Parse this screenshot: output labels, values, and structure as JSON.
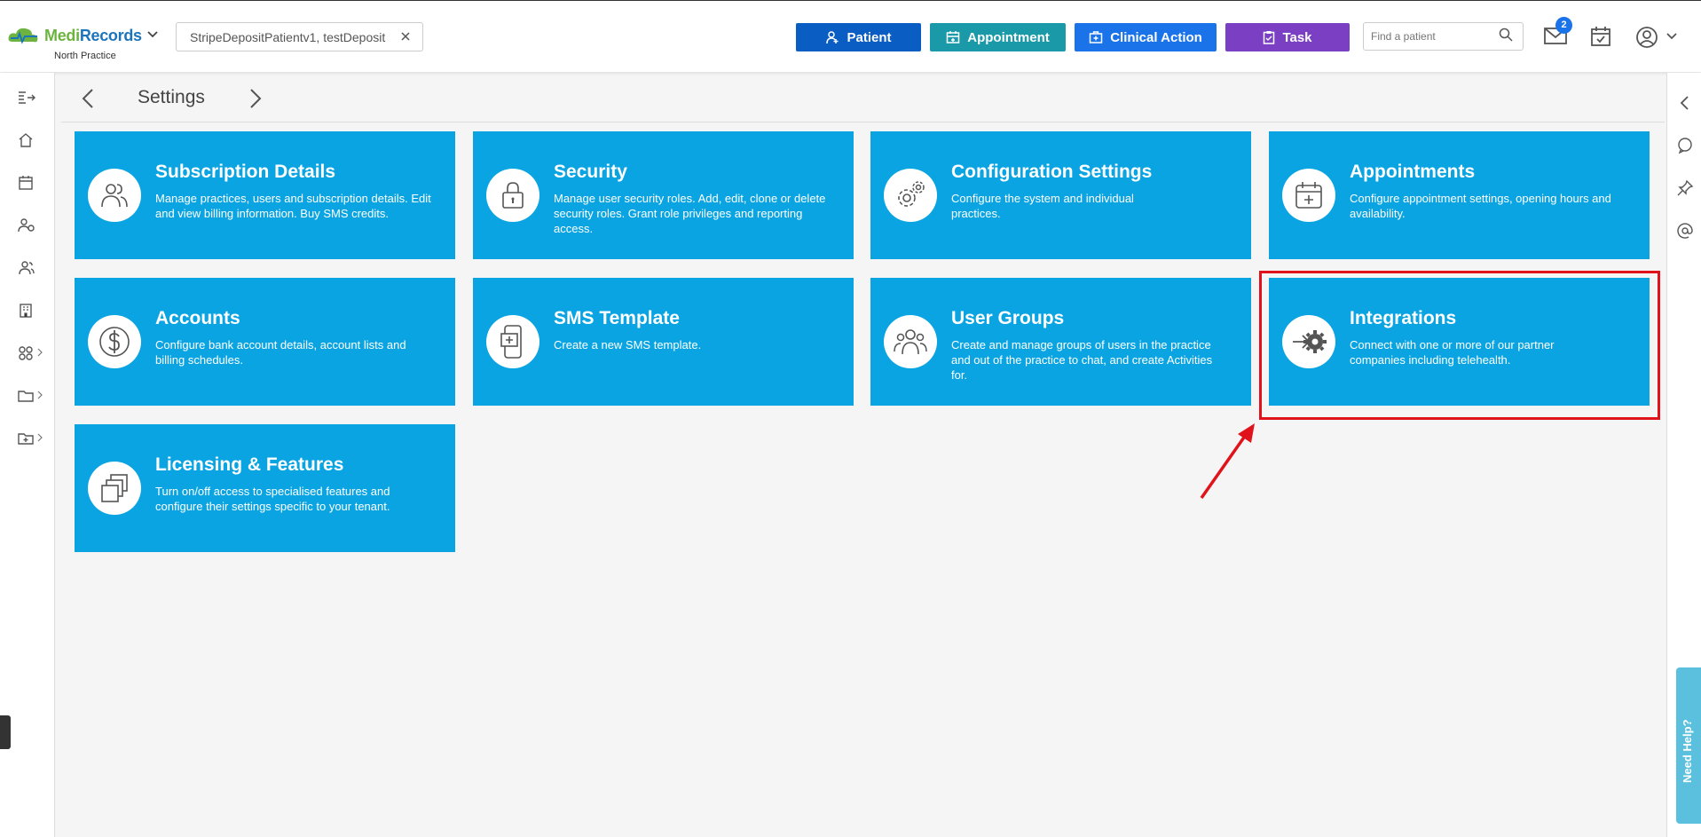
{
  "header": {
    "logo_medi": "Medi",
    "logo_records": "Records",
    "practice": "North Practice",
    "patient_chip": "StripeDepositPatientv1, testDeposit",
    "buttons": [
      {
        "label": "Patient",
        "color": "#0a5dc2",
        "icon": "add-user-icon"
      },
      {
        "label": "Appointment",
        "color": "#1a9aa8",
        "icon": "calendar-icon"
      },
      {
        "label": "Clinical Action",
        "color": "#1a73e8",
        "icon": "medical-kit-icon"
      },
      {
        "label": "Task",
        "color": "#7b3fc4",
        "icon": "clipboard-icon"
      }
    ],
    "search_placeholder": "Find a patient",
    "mail_badge": "2"
  },
  "page": {
    "title": "Settings"
  },
  "cards": [
    {
      "title": "Subscription Details",
      "desc": "Manage practices, users and subscription details. Edit and view billing information. Buy SMS credits.",
      "icon": "users-icon"
    },
    {
      "title": "Security",
      "desc": "Manage user security roles. Add, edit, clone or delete security roles. Grant role privileges and reporting access.",
      "icon": "lock-icon"
    },
    {
      "title": "Configuration Settings",
      "desc": "Configure the system and individual practices.",
      "icon": "gears-icon"
    },
    {
      "title": "Appointments",
      "desc": "Configure appointment settings, opening hours and availability.",
      "icon": "calendar-plus-icon"
    },
    {
      "title": "Accounts",
      "desc": "Configure bank account details, account lists and billing schedules.",
      "icon": "dollar-icon"
    },
    {
      "title": "SMS Template",
      "desc": "Create a new SMS template.",
      "icon": "phone-message-icon"
    },
    {
      "title": "User Groups",
      "desc": "Create and manage groups of users in the practice and out of the practice to chat, and create Activities for.",
      "icon": "user-group-icon"
    },
    {
      "title": "Integrations",
      "desc": "Connect with one or more of our partner companies including telehealth.",
      "icon": "integration-gear-icon"
    },
    {
      "title": "Licensing & Features",
      "desc": "Turn on/off access to specialised features and configure their settings specific to your tenant.",
      "icon": "layers-icon"
    }
  ],
  "help": {
    "label": "Need Help?"
  },
  "colors": {
    "card": "#0aa4e2",
    "highlight": "#e0131b"
  }
}
